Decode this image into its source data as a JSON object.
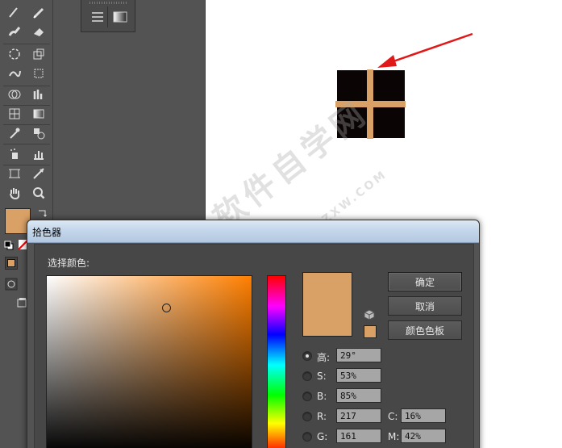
{
  "dialog": {
    "title": "拾色器",
    "select_label": "选择颜色:",
    "ok": "确定",
    "cancel": "取消",
    "swatches": "颜色色板",
    "fields": {
      "h": {
        "label": "高:",
        "value": "29°"
      },
      "s": {
        "label": "S:",
        "value": "53%"
      },
      "b": {
        "label": "B:",
        "value": "85%"
      },
      "r": {
        "label": "R:",
        "value": "217"
      },
      "g": {
        "label": "G:",
        "value": "161"
      },
      "c": {
        "label": "C:",
        "value": "16%"
      },
      "m": {
        "label": "M:",
        "value": "42%"
      }
    }
  },
  "watermark": {
    "main": "软件自学网",
    "sub": "WWW.RJZXW.COM"
  },
  "colors": {
    "selected": "#d9a166",
    "artwork_square": "#0a0404",
    "arrow": "#e01818"
  },
  "icons": {
    "toolbox": [
      "brush-icon",
      "pencil-icon",
      "blob-brush-icon",
      "eraser-icon",
      "rotate-icon",
      "scale-icon",
      "warp-icon",
      "free-transform-icon",
      "shape-builder-icon",
      "graph-icon",
      "mesh-icon",
      "gradient-icon",
      "eyedropper-icon",
      "blend-icon",
      "symbol-sprayer-icon",
      "column-graph-icon",
      "artboard-icon",
      "slice-icon",
      "hand-icon",
      "zoom-icon"
    ]
  }
}
